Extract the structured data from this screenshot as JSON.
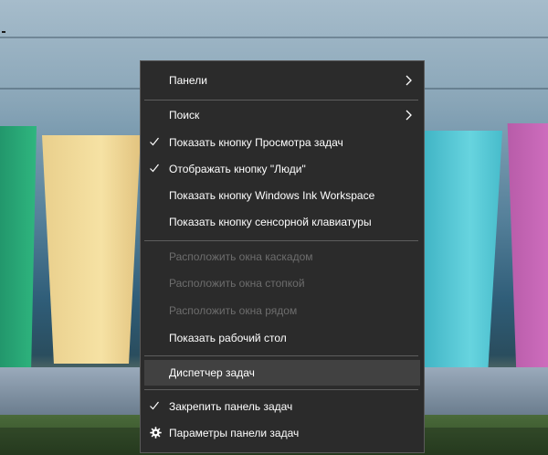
{
  "context_menu": {
    "items": {
      "panels": "Панели",
      "search": "Поиск",
      "show_task_view": "Показать кнопку Просмотра задач",
      "show_people": "Отображать кнопку \"Люди\"",
      "show_ink_workspace": "Показать кнопку Windows Ink Workspace",
      "show_touch_keyboard": "Показать кнопку сенсорной клавиатуры",
      "cascade_windows": "Расположить окна каскадом",
      "stack_windows": "Расположить окна стопкой",
      "side_by_side": "Расположить окна рядом",
      "show_desktop": "Показать рабочий стол",
      "task_manager": "Диспетчер задач",
      "lock_taskbar": "Закрепить панель задач",
      "taskbar_settings": "Параметры панели задач"
    },
    "checked": {
      "show_task_view": true,
      "show_people": true,
      "lock_taskbar": true
    },
    "disabled": [
      "cascade_windows",
      "stack_windows",
      "side_by_side"
    ],
    "highlighted": "task_manager",
    "icons": {
      "submenu": "chevron-right-icon",
      "check": "checkmark-icon",
      "settings": "gear-icon"
    },
    "colors": {
      "background": "#2b2b2b",
      "text": "#ffffff",
      "disabled_text": "#6d6d6d",
      "highlight": "#414141"
    }
  }
}
